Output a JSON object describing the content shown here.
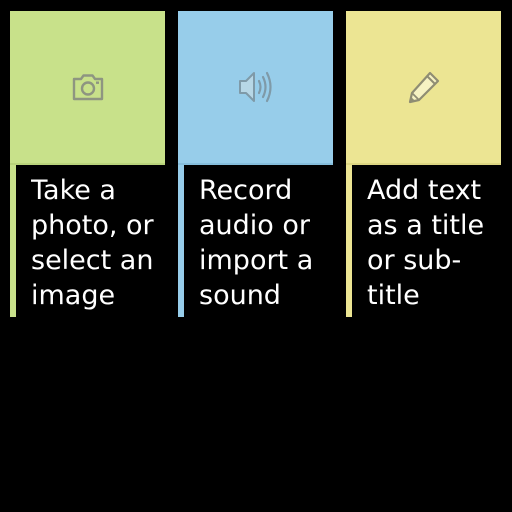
{
  "cards": [
    {
      "label": "Take a photo, or select an image",
      "icon": "camera-icon",
      "color": "#c8e18a"
    },
    {
      "label": "Record audio or import a sound",
      "icon": "speaker-icon",
      "color": "#97cdea"
    },
    {
      "label": "Add text as a title or sub-title",
      "icon": "pencil-icon",
      "color": "#ece593"
    }
  ],
  "icon_color": "#8a8f7e"
}
